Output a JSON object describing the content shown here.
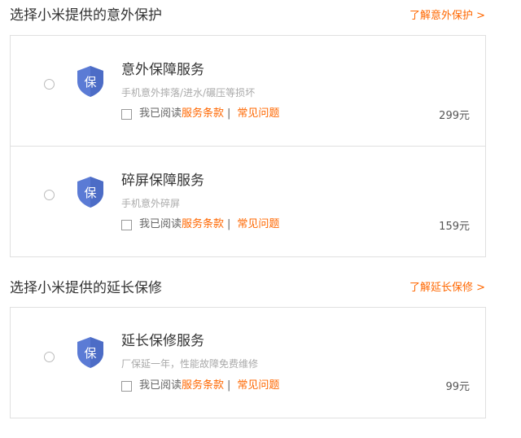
{
  "sections": [
    {
      "title": "选择小米提供的意外保护",
      "link": "了解意外保护 >",
      "items": [
        {
          "badge": "保",
          "title": "意外保障服务",
          "desc": "手机意外摔落/进水/碾压等损坏",
          "agree_prefix": "我已阅读",
          "terms": "服务条款",
          "separator": "|",
          "faq": "常见问题",
          "price": "299元"
        },
        {
          "badge": "保",
          "title": "碎屏保障服务",
          "desc": "手机意外碎屏",
          "agree_prefix": "我已阅读",
          "terms": "服务条款",
          "separator": "|",
          "faq": "常见问题",
          "price": "159元"
        }
      ]
    },
    {
      "title": "选择小米提供的延长保修",
      "link": "了解延长保修 >",
      "items": [
        {
          "badge": "保",
          "title": "延长保修服务",
          "desc": "厂保延一年，性能故障免费维修",
          "agree_prefix": "我已阅读",
          "terms": "服务条款",
          "separator": "|",
          "faq": "常见问题",
          "price": "99元"
        }
      ]
    }
  ],
  "colors": {
    "accent": "#ff6700",
    "shield": "#5b7bd5",
    "border": "#e0e0e0"
  }
}
